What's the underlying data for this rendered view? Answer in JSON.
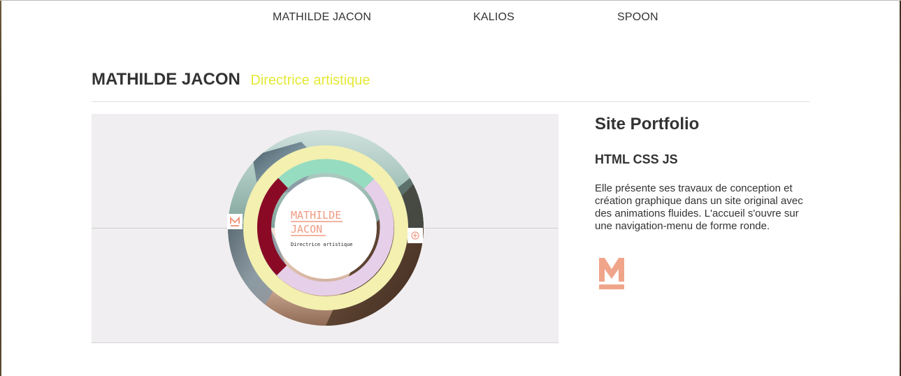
{
  "nav": {
    "items": [
      {
        "label": "MATHILDE JACON"
      },
      {
        "label": "KALIOS"
      },
      {
        "label": "SPOON"
      }
    ]
  },
  "header": {
    "name": "MATHILDE JACON",
    "role": "Directrice artistique"
  },
  "preview": {
    "title_line1": "MATHILDE",
    "title_line2": "JACON",
    "subtitle": "Directrice artistique",
    "colors": {
      "pink": "#f09a82",
      "mint": "#96dcc0",
      "yellow": "#f3f0b0",
      "lavender": "#e6cfe8",
      "crimson": "#8a0a26"
    }
  },
  "side": {
    "title": "Site Portfolio",
    "tech": "HTML CSS JS",
    "description": "Elle présente ses travaux de conception et création graphique dans un site original avec des animations fluides. L'accueil s'ouvre sur une navigation-menu de forme ronde."
  },
  "colors": {
    "accent_yellow": "#e4e935",
    "logo_pink": "#f0a58a",
    "text": "#333333"
  }
}
